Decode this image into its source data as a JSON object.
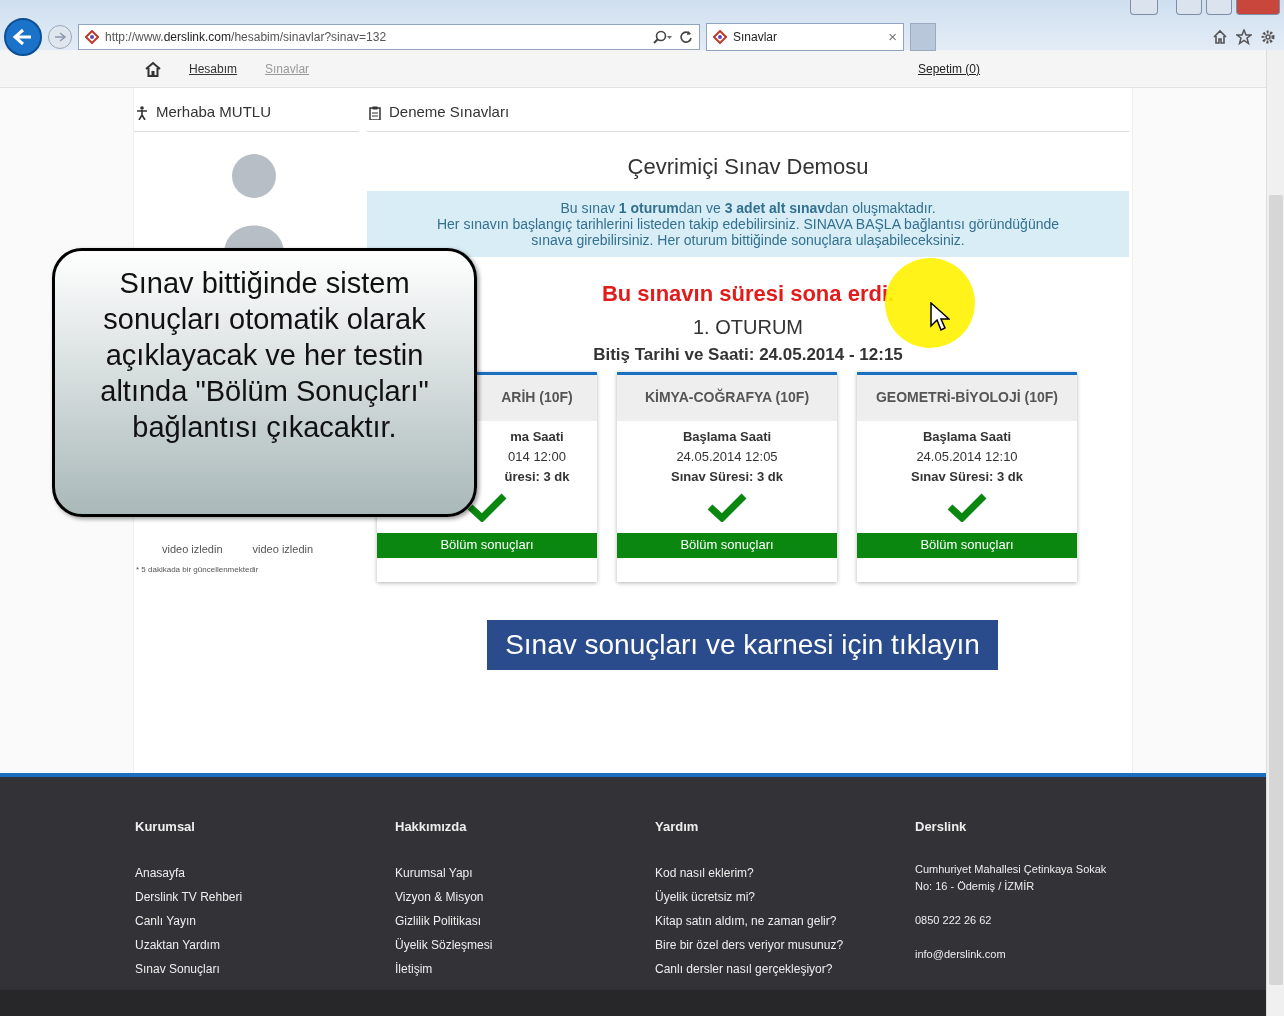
{
  "browser": {
    "address_prefix": "http://www.",
    "address_domain": "derslink.com",
    "address_path": "/hesabim/sinavlar?sinav=132",
    "tab_title": "Sınavlar",
    "tab_close": "×"
  },
  "breadcrumb": [
    {
      "label": "Hesabım",
      "selected": false
    },
    {
      "label": "Sınavlar",
      "selected": true
    }
  ],
  "cart": "Sepetim (0)",
  "sidebar": {
    "greeting": "Merhaba MUTLU",
    "stats": [
      {
        "label": "video izledin"
      },
      {
        "label": "video izledin"
      }
    ],
    "footnote": "* 5 dakikada bir güncellenmektedir"
  },
  "main": {
    "section_title": "Deneme Sınavları",
    "title": "Çevrimiçi Sınav Demosu",
    "info_lines": [
      "Bu sınav **1 oturum**dan ve **3 adet alt sınav**dan oluşmaktadır.",
      "Her sınavın başlangıç tarihlerini listeden takip edebilirsiniz. SINAVA BAŞLA bağlantısı göründüğünde",
      "sınava girebilirsiniz. Her oturum bittiğinde sonuçlara ulaşabileceksiniz."
    ],
    "expired_message": "Bu sınavın süresi sona erdi.",
    "session": "1. OTURUM",
    "end_time": "Bitiş Tarihi ve Saati: 24.05.2014 - 12:15",
    "exams": [
      {
        "title": "ARİH (10F)",
        "start_label": "ma Saati",
        "start_time": "014 12:00",
        "duration": "üresi: 3 dk",
        "completed": true,
        "results_button": "Bölüm sonuçları"
      },
      {
        "title": "KİMYA-COĞRAFYA (10F)",
        "start_label": "Başlama Saati",
        "start_time": "24.05.2014 12:05",
        "duration": "Sınav Süresi: 3 dk",
        "completed": true,
        "results_button": "Bölüm sonuçları"
      },
      {
        "title": "GEOMETRİ-BİYOLOJİ (10F)",
        "start_label": "Başlama Saati",
        "start_time": "24.05.2014 12:10",
        "duration": "Sınav Süresi: 3 dk",
        "completed": true,
        "results_button": "Bölüm sonuçları"
      }
    ],
    "results_link": "Sınav sonuçları ve karnesi için tıklayın"
  },
  "footer": {
    "columns": [
      {
        "heading": "Kurumsal",
        "links": [
          "Anasayfa",
          "Derslink TV Rehberi",
          "Canlı Yayın",
          "Uzaktan Yardım",
          "Sınav Sonuçları"
        ]
      },
      {
        "heading": "Hakkımızda",
        "links": [
          "Kurumsal Yapı",
          "Vizyon & Misyon",
          "Gizlilik Politikası",
          "Üyelik Sözleşmesi",
          "İletişim"
        ]
      },
      {
        "heading": "Yardım",
        "links": [
          "Kod nasıl eklerim?",
          "Üyelik ücretsiz mi?",
          "Kitap satın aldım, ne zaman gelir?",
          "Bire bir özel ders veriyor musunuz?",
          "Canlı dersler nasıl gerçekleşiyor?"
        ]
      }
    ],
    "contact": {
      "heading": "Derslink",
      "address_lines": [
        "Cumhuriyet Mahallesi Çetinkaya Sokak",
        "No: 16 - Ödemiş / İZMİR"
      ],
      "phone": "0850 222 26 62",
      "email": "info@derslink.com"
    }
  },
  "callout": {
    "lines": [
      "Sınav bittiğinde sistem",
      "sonuçları otomatik olarak",
      "açıklayacak ve her testin",
      "altında \"Bölüm Sonuçları\"",
      "bağlantısı çıkacaktır."
    ]
  }
}
